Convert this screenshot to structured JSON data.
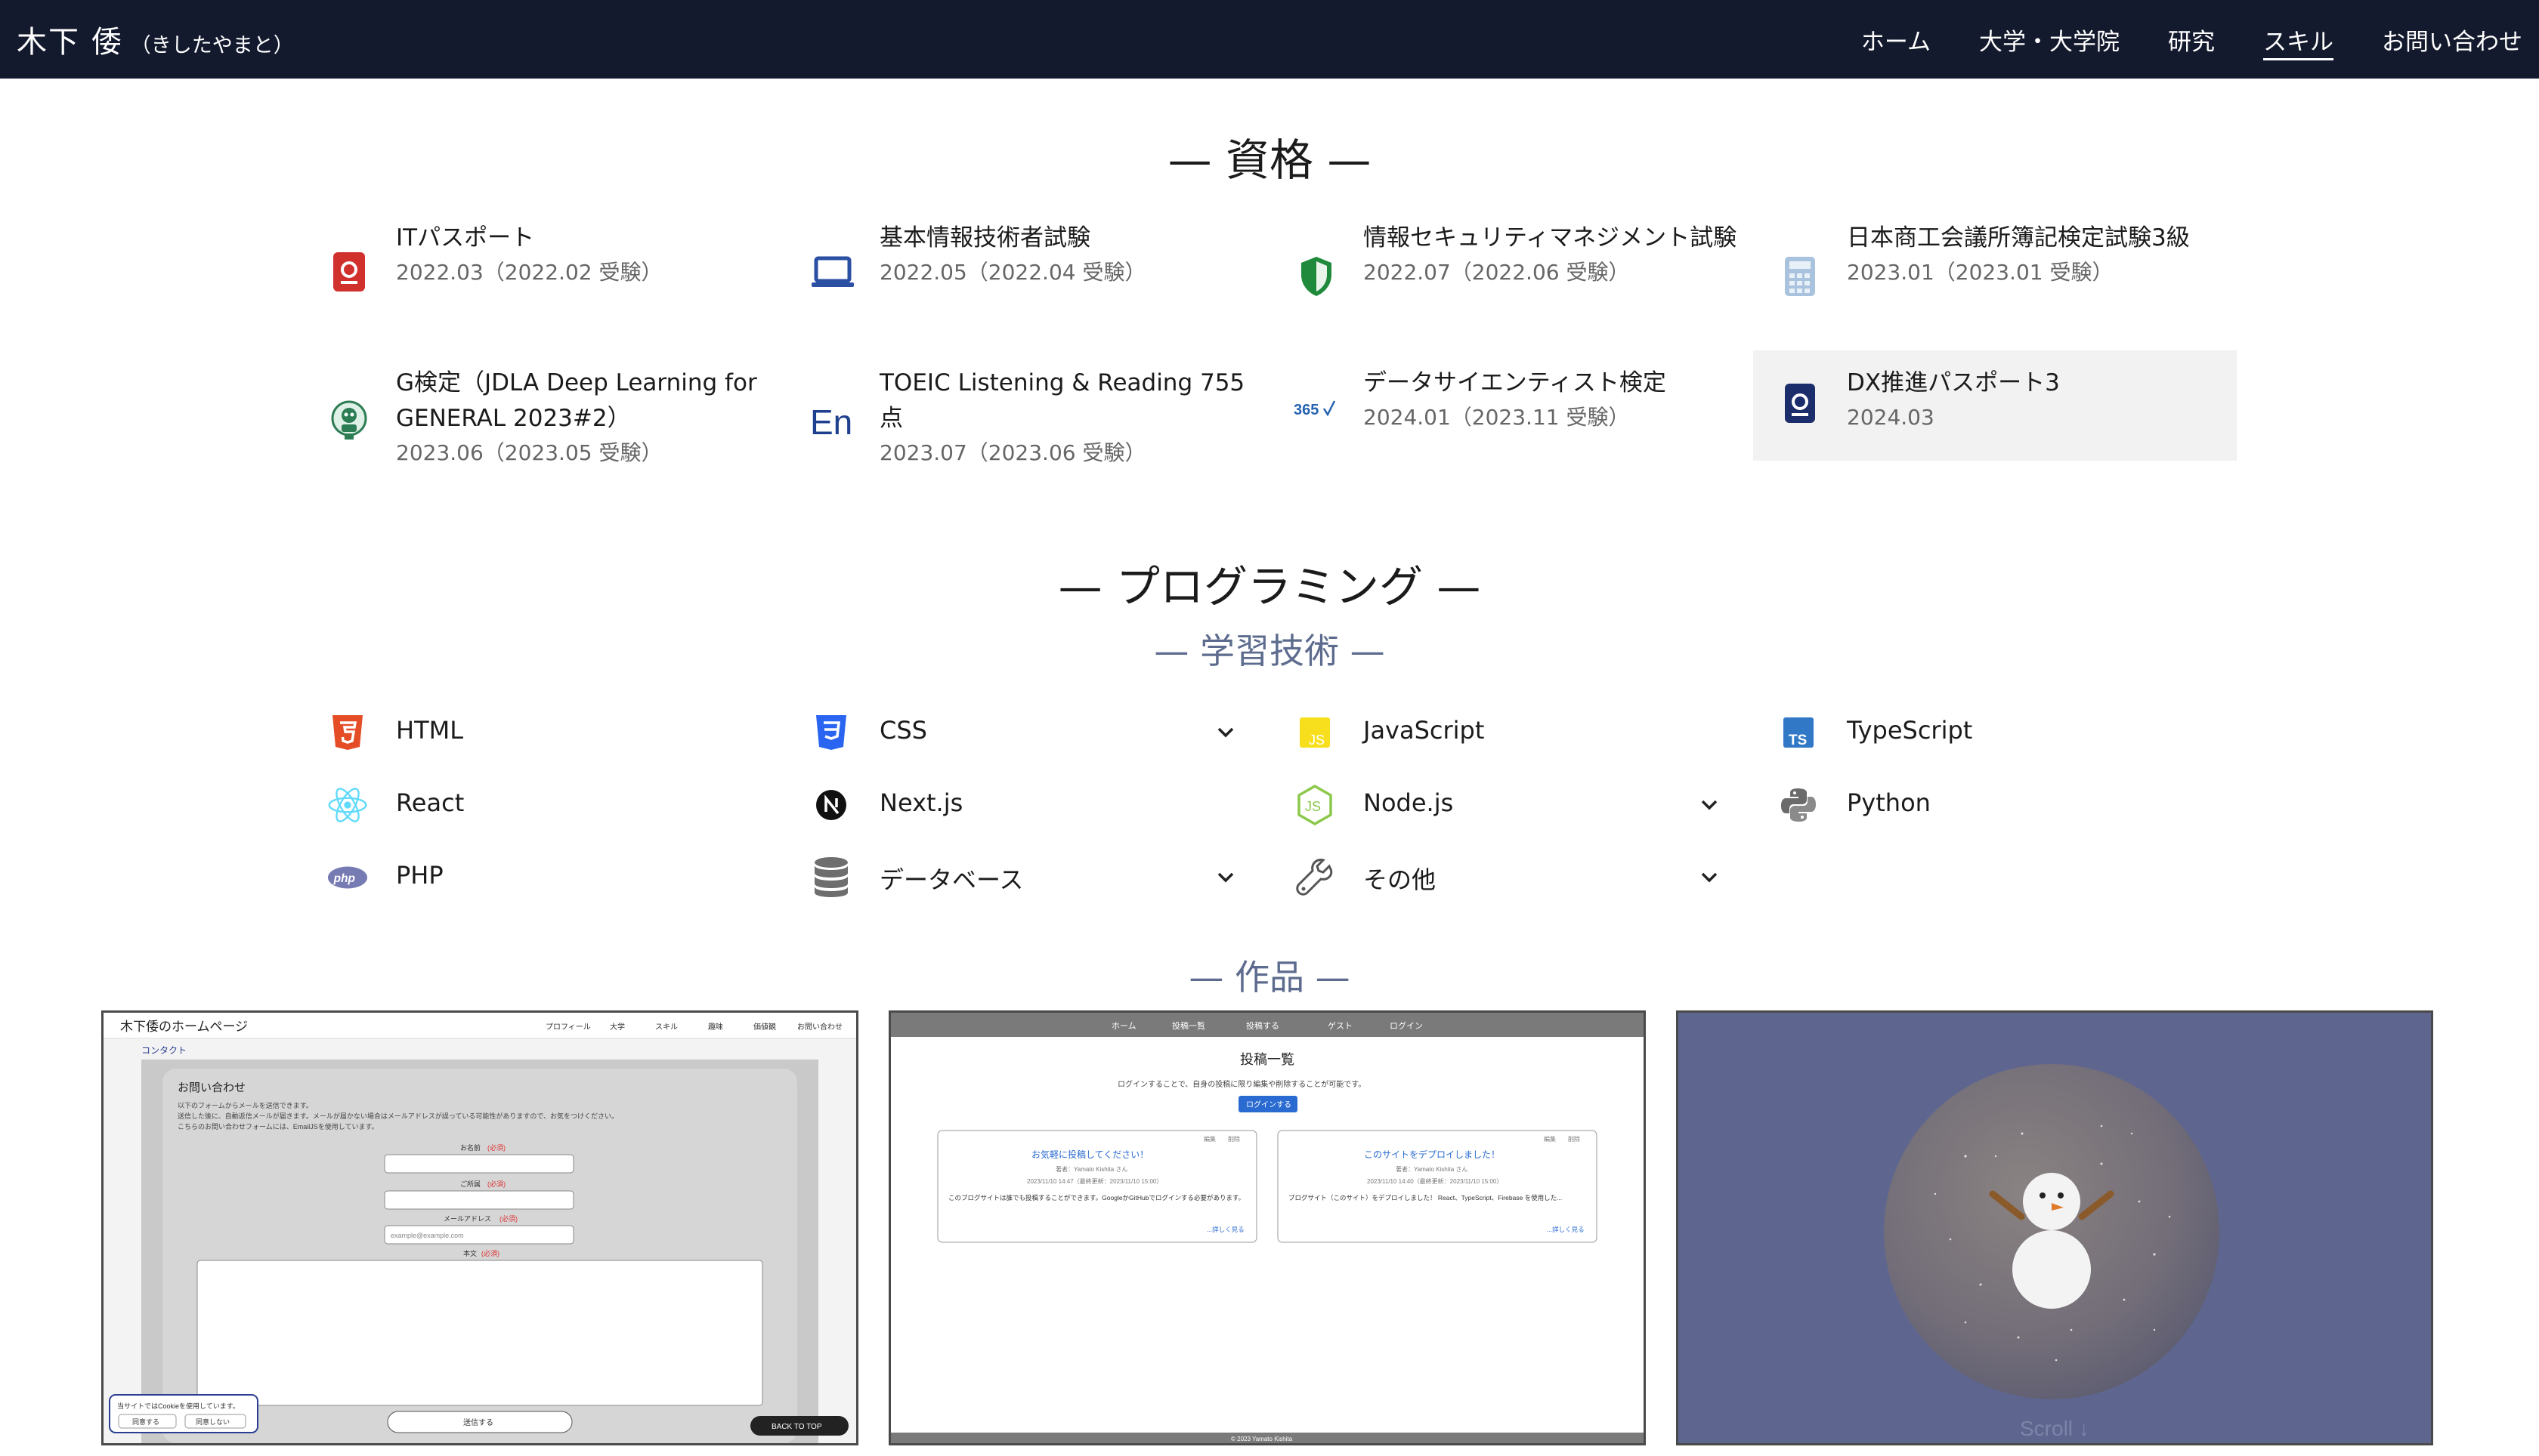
{
  "header": {
    "name": "木下 倭",
    "reading": "（きしたやまと）",
    "nav": [
      {
        "label": "ホーム"
      },
      {
        "label": "大学・大学院"
      },
      {
        "label": "研究"
      },
      {
        "label": "スキル"
      },
      {
        "label": "お問い合わせ"
      }
    ]
  },
  "qualifications": {
    "title": "— 資格 —",
    "items": [
      {
        "name": "ITパスポート",
        "date": "2022.03（2022.02 受験）",
        "icon": "passport-icon",
        "color": "#d0312d"
      },
      {
        "name": "基本情報技術者試験",
        "date": "2022.05（2022.04 受験）",
        "icon": "laptop-icon",
        "color": "#2a4fa3"
      },
      {
        "name": "情報セキュリティマネジメント試験",
        "date": "2022.07（2022.06 受験）",
        "icon": "shield-icon",
        "color": "#1f8a3b"
      },
      {
        "name": "日本商工会議所簿記検定試験3級",
        "date": "2023.01（2023.01 受験）",
        "icon": "calculator-icon",
        "color": "#9fb9d6"
      },
      {
        "name": "G検定（JDLA Deep Learning for GENERAL 2023#2）",
        "date": "2023.06（2023.05 受験）",
        "icon": "robot-badge-icon",
        "color": "#2d7d54"
      },
      {
        "name": "TOEIC Listening & Reading 755点",
        "date": "2023.07（2023.06 受験）",
        "icon": "en-text-icon",
        "color": "#1f3f8f"
      },
      {
        "name": "データサイエンティスト検定",
        "date": "2024.01（2023.11 受験）",
        "icon": "365-logo-icon",
        "color": "#2563b0"
      },
      {
        "name": "DX推進パスポート3",
        "date": "2024.03",
        "icon": "passport-dark-icon",
        "color": "#1b2d6b"
      }
    ]
  },
  "programming": {
    "title": "— プログラミング —",
    "subtitle": "— 学習技術 —",
    "items": [
      {
        "label": "HTML",
        "icon": "html5-icon",
        "expandable": false
      },
      {
        "label": "CSS",
        "icon": "css3-icon",
        "expandable": true
      },
      {
        "label": "JavaScript",
        "icon": "js-icon",
        "expandable": false
      },
      {
        "label": "TypeScript",
        "icon": "ts-icon",
        "expandable": false
      },
      {
        "label": "React",
        "icon": "react-icon",
        "expandable": false
      },
      {
        "label": "Next.js",
        "icon": "nextjs-icon",
        "expandable": false
      },
      {
        "label": "Node.js",
        "icon": "nodejs-icon",
        "expandable": true
      },
      {
        "label": "Python",
        "icon": "python-icon",
        "expandable": false
      },
      {
        "label": "PHP",
        "icon": "php-icon",
        "expandable": false
      },
      {
        "label": "データベース",
        "icon": "database-icon",
        "expandable": true
      },
      {
        "label": "その他",
        "icon": "wrench-icon",
        "expandable": true
      }
    ]
  },
  "works": {
    "title": "— 作品 —",
    "contact_shot": {
      "site_title": "木下倭のホームページ",
      "nav": [
        "プロフィール",
        "大学",
        "スキル",
        "趣味",
        "価値観",
        "お問い合わせ"
      ],
      "breadcrumb": "コンタクト",
      "heading": "お問い合わせ",
      "intro1": "以下のフォームからメールを送信できます。",
      "intro2": "送信した後に、自動返信メールが届きます。メールが届かない場合はメールアドレスが誤っている可能性がありますので、お気をつけください。",
      "intro3": "こちらのお問い合わせフォームには、EmailJSを使用しています。",
      "label_name": "お名前",
      "label_org": "ご所属",
      "label_email": "メールアドレス",
      "label_body": "本文",
      "required": "(必須)",
      "email_placeholder": "example@example.com",
      "submit": "送信する",
      "back_to_top": "BACK TO TOP",
      "cookie_text": "当サイトではCookieを使用しています。",
      "cookie_agree": "同意する",
      "cookie_decline": "同意しない"
    },
    "blog_shot": {
      "nav": [
        "ホーム",
        "投稿一覧",
        "投稿する",
        "ゲスト",
        "ログイン"
      ],
      "heading": "投稿一覧",
      "notice": "ログインすることで、自身の投稿に限り編集や削除することが可能です。",
      "login": "ログインする",
      "posts": [
        {
          "title": "お気軽に投稿してください！",
          "author": "著者：Yamato Kishita さん",
          "dates": "2023/11/10 14:47（最終更新：2023/11/10 15:00）",
          "body": "このブログサイトは誰でも投稿することができます。GoogleかGitHubでログインする必要があります。",
          "more": "...詳しく見る",
          "edit": "編集",
          "del": "削除"
        },
        {
          "title": "このサイトをデプロイしました！",
          "author": "著者：Yamato Kishita さん",
          "dates": "2023/11/10 14:40（最終更新：2023/11/10 15:00）",
          "body": "ブログサイト（このサイト）をデプロイしました！ React、TypeScript、Firebase を使用した...",
          "more": "...詳しく見る",
          "edit": "編集",
          "del": "削除"
        }
      ],
      "footer": "© 2023 Yamato Kishita"
    },
    "snow_shot": {
      "scroll_text": "Scroll ↓",
      "bg_color": "#5e6690"
    }
  }
}
